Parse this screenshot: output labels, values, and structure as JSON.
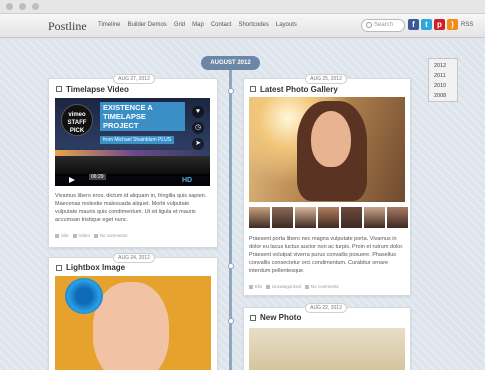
{
  "brand": "Postline",
  "nav": [
    "Timeline",
    "Builder Demos",
    "Grid",
    "Map",
    "Contact",
    "Shortcodes",
    "Layouts"
  ],
  "search": {
    "placeholder": "Search"
  },
  "social": [
    {
      "icon": "facebook-icon",
      "glyph": "f",
      "color": "#3b5998"
    },
    {
      "icon": "twitter-icon",
      "glyph": "t",
      "color": "#2fa6dc"
    },
    {
      "icon": "pinterest-icon",
      "glyph": "p",
      "color": "#cb2027"
    },
    {
      "icon": "rss-icon",
      "glyph": ")",
      "color": "#f28b1a"
    }
  ],
  "rss_label": "RSS",
  "timeline": {
    "heading": "AUGUST 2012"
  },
  "years": [
    "2012",
    "2011",
    "2010",
    "2008"
  ],
  "posts": [
    {
      "date": "AUG 27, 2012",
      "title": "Timelapse Video",
      "video": {
        "badge_top": "vimeo",
        "badge_main": "STAFF PICK",
        "headline": "EXISTENCE A TIMELAPSE PROJECT",
        "from": "from Michael Shainblum",
        "plus": "PLUS",
        "time": "06:29",
        "hd": "HD"
      },
      "excerpt": "Vivamus libero eros, dictum id aliquam in, fringilla quis sapien. Maecenas molestie malesuada aliquet. Morbi vulputate vulputate mauris quis condimentum. Ut sit ligula et mauris accumsan tristique eget nunc.",
      "meta": {
        "author": "Site",
        "category": "Video",
        "comments": "No comments"
      }
    },
    {
      "date": "AUG 25, 2012",
      "title": "Latest Photo Gallery",
      "excerpt": "Praesent porta libero nec magna vulputate porta. Vivamus in dolor eu lacus luctus auctor non ac turpis. Proin et rutrum dolor. Praesent volutpat viverra purus convallis posuere. Phasellus convallis consectetur orci condimentum. Curabitur ornare interdum pellentesque.",
      "meta": {
        "author": "Elis",
        "category": "Uncategorized",
        "comments": "No comments"
      }
    },
    {
      "date": "AUG 24, 2012",
      "title": "Lightbox Image"
    },
    {
      "date": "AUG 22, 2012",
      "title": "New Photo"
    }
  ],
  "thumb_colors": [
    "#c6a080",
    "#8a6a58",
    "#d7b69a",
    "#b47e5c",
    "#6b4a3c",
    "#c9a58c",
    "#a67a66"
  ]
}
